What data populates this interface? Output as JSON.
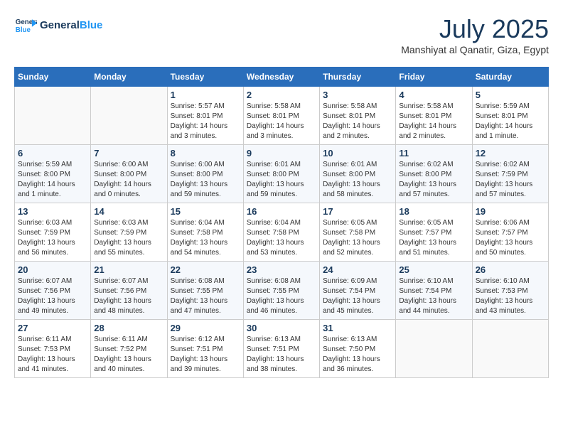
{
  "header": {
    "logo_line1": "General",
    "logo_line2": "Blue",
    "month_title": "July 2025",
    "location": "Manshiyat al Qanatir, Giza, Egypt"
  },
  "weekdays": [
    "Sunday",
    "Monday",
    "Tuesday",
    "Wednesday",
    "Thursday",
    "Friday",
    "Saturday"
  ],
  "weeks": [
    [
      {
        "day": "",
        "info": ""
      },
      {
        "day": "",
        "info": ""
      },
      {
        "day": "1",
        "info": "Sunrise: 5:57 AM\nSunset: 8:01 PM\nDaylight: 14 hours and 3 minutes."
      },
      {
        "day": "2",
        "info": "Sunrise: 5:58 AM\nSunset: 8:01 PM\nDaylight: 14 hours and 3 minutes."
      },
      {
        "day": "3",
        "info": "Sunrise: 5:58 AM\nSunset: 8:01 PM\nDaylight: 14 hours and 2 minutes."
      },
      {
        "day": "4",
        "info": "Sunrise: 5:58 AM\nSunset: 8:01 PM\nDaylight: 14 hours and 2 minutes."
      },
      {
        "day": "5",
        "info": "Sunrise: 5:59 AM\nSunset: 8:01 PM\nDaylight: 14 hours and 1 minute."
      }
    ],
    [
      {
        "day": "6",
        "info": "Sunrise: 5:59 AM\nSunset: 8:00 PM\nDaylight: 14 hours and 1 minute."
      },
      {
        "day": "7",
        "info": "Sunrise: 6:00 AM\nSunset: 8:00 PM\nDaylight: 14 hours and 0 minutes."
      },
      {
        "day": "8",
        "info": "Sunrise: 6:00 AM\nSunset: 8:00 PM\nDaylight: 13 hours and 59 minutes."
      },
      {
        "day": "9",
        "info": "Sunrise: 6:01 AM\nSunset: 8:00 PM\nDaylight: 13 hours and 59 minutes."
      },
      {
        "day": "10",
        "info": "Sunrise: 6:01 AM\nSunset: 8:00 PM\nDaylight: 13 hours and 58 minutes."
      },
      {
        "day": "11",
        "info": "Sunrise: 6:02 AM\nSunset: 8:00 PM\nDaylight: 13 hours and 57 minutes."
      },
      {
        "day": "12",
        "info": "Sunrise: 6:02 AM\nSunset: 7:59 PM\nDaylight: 13 hours and 57 minutes."
      }
    ],
    [
      {
        "day": "13",
        "info": "Sunrise: 6:03 AM\nSunset: 7:59 PM\nDaylight: 13 hours and 56 minutes."
      },
      {
        "day": "14",
        "info": "Sunrise: 6:03 AM\nSunset: 7:59 PM\nDaylight: 13 hours and 55 minutes."
      },
      {
        "day": "15",
        "info": "Sunrise: 6:04 AM\nSunset: 7:58 PM\nDaylight: 13 hours and 54 minutes."
      },
      {
        "day": "16",
        "info": "Sunrise: 6:04 AM\nSunset: 7:58 PM\nDaylight: 13 hours and 53 minutes."
      },
      {
        "day": "17",
        "info": "Sunrise: 6:05 AM\nSunset: 7:58 PM\nDaylight: 13 hours and 52 minutes."
      },
      {
        "day": "18",
        "info": "Sunrise: 6:05 AM\nSunset: 7:57 PM\nDaylight: 13 hours and 51 minutes."
      },
      {
        "day": "19",
        "info": "Sunrise: 6:06 AM\nSunset: 7:57 PM\nDaylight: 13 hours and 50 minutes."
      }
    ],
    [
      {
        "day": "20",
        "info": "Sunrise: 6:07 AM\nSunset: 7:56 PM\nDaylight: 13 hours and 49 minutes."
      },
      {
        "day": "21",
        "info": "Sunrise: 6:07 AM\nSunset: 7:56 PM\nDaylight: 13 hours and 48 minutes."
      },
      {
        "day": "22",
        "info": "Sunrise: 6:08 AM\nSunset: 7:55 PM\nDaylight: 13 hours and 47 minutes."
      },
      {
        "day": "23",
        "info": "Sunrise: 6:08 AM\nSunset: 7:55 PM\nDaylight: 13 hours and 46 minutes."
      },
      {
        "day": "24",
        "info": "Sunrise: 6:09 AM\nSunset: 7:54 PM\nDaylight: 13 hours and 45 minutes."
      },
      {
        "day": "25",
        "info": "Sunrise: 6:10 AM\nSunset: 7:54 PM\nDaylight: 13 hours and 44 minutes."
      },
      {
        "day": "26",
        "info": "Sunrise: 6:10 AM\nSunset: 7:53 PM\nDaylight: 13 hours and 43 minutes."
      }
    ],
    [
      {
        "day": "27",
        "info": "Sunrise: 6:11 AM\nSunset: 7:53 PM\nDaylight: 13 hours and 41 minutes."
      },
      {
        "day": "28",
        "info": "Sunrise: 6:11 AM\nSunset: 7:52 PM\nDaylight: 13 hours and 40 minutes."
      },
      {
        "day": "29",
        "info": "Sunrise: 6:12 AM\nSunset: 7:51 PM\nDaylight: 13 hours and 39 minutes."
      },
      {
        "day": "30",
        "info": "Sunrise: 6:13 AM\nSunset: 7:51 PM\nDaylight: 13 hours and 38 minutes."
      },
      {
        "day": "31",
        "info": "Sunrise: 6:13 AM\nSunset: 7:50 PM\nDaylight: 13 hours and 36 minutes."
      },
      {
        "day": "",
        "info": ""
      },
      {
        "day": "",
        "info": ""
      }
    ]
  ]
}
